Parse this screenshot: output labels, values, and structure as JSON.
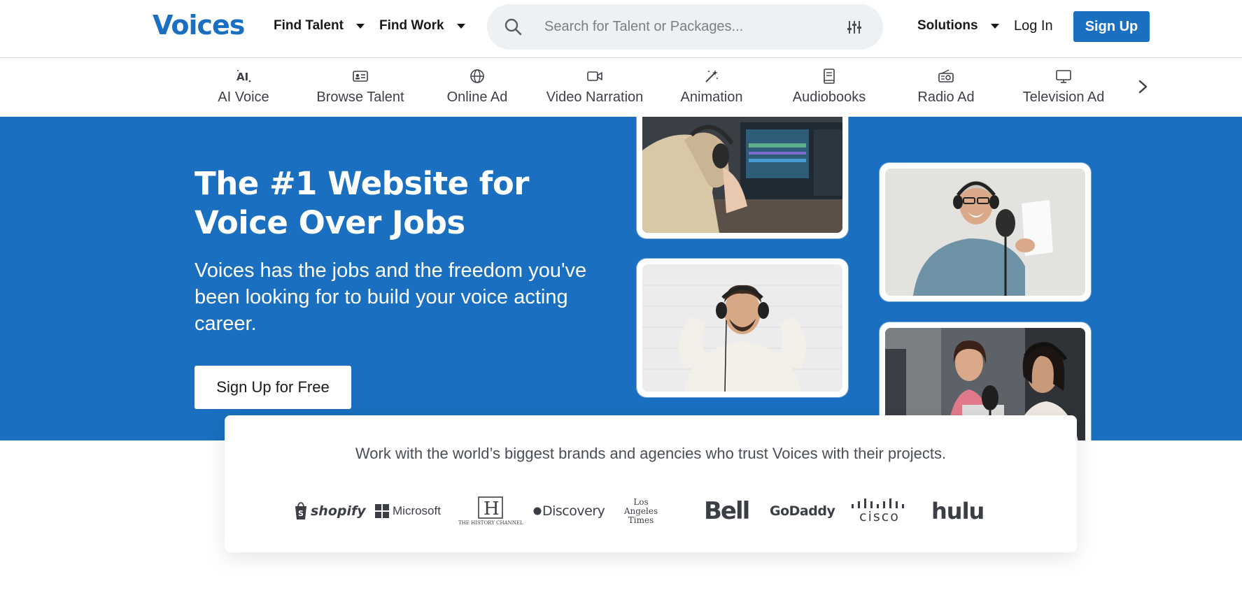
{
  "header": {
    "logo": "Voices",
    "nav": [
      {
        "label": "Find Talent"
      },
      {
        "label": "Find Work"
      }
    ],
    "search_placeholder": "Search for Talent or Packages...",
    "solutions_label": "Solutions",
    "login_label": "Log In",
    "signup_label": "Sign Up"
  },
  "categories": [
    {
      "label": "AI Voice",
      "icon": "ai-icon"
    },
    {
      "label": "Browse Talent",
      "icon": "id-card-icon"
    },
    {
      "label": "Online Ad",
      "icon": "globe-icon"
    },
    {
      "label": "Video Narration",
      "icon": "video-camera-icon"
    },
    {
      "label": "Animation",
      "icon": "magic-wand-icon"
    },
    {
      "label": "Audiobooks",
      "icon": "book-icon"
    },
    {
      "label": "Radio Ad",
      "icon": "radio-icon"
    },
    {
      "label": "Television Ad",
      "icon": "monitor-icon"
    }
  ],
  "hero": {
    "title": "The #1 Website for Voice Over Jobs",
    "subtitle": "Voices has the jobs and the freedom you've been looking for to build your voice acting career.",
    "cta_label": "Sign Up for Free"
  },
  "brands": {
    "intro": "Work with the world’s biggest brands and agencies who trust Voices with their projects.",
    "logos": [
      "shopify",
      "Microsoft",
      "THE HISTORY CHANNEL",
      "Discovery",
      "Los Angeles Times",
      "Bell",
      "GoDaddy",
      "cisco",
      "hulu"
    ]
  },
  "colors": {
    "brand_blue": "#1a6fc0",
    "hero_bg": "#1a6fc0",
    "search_bg": "#eef1f4"
  }
}
